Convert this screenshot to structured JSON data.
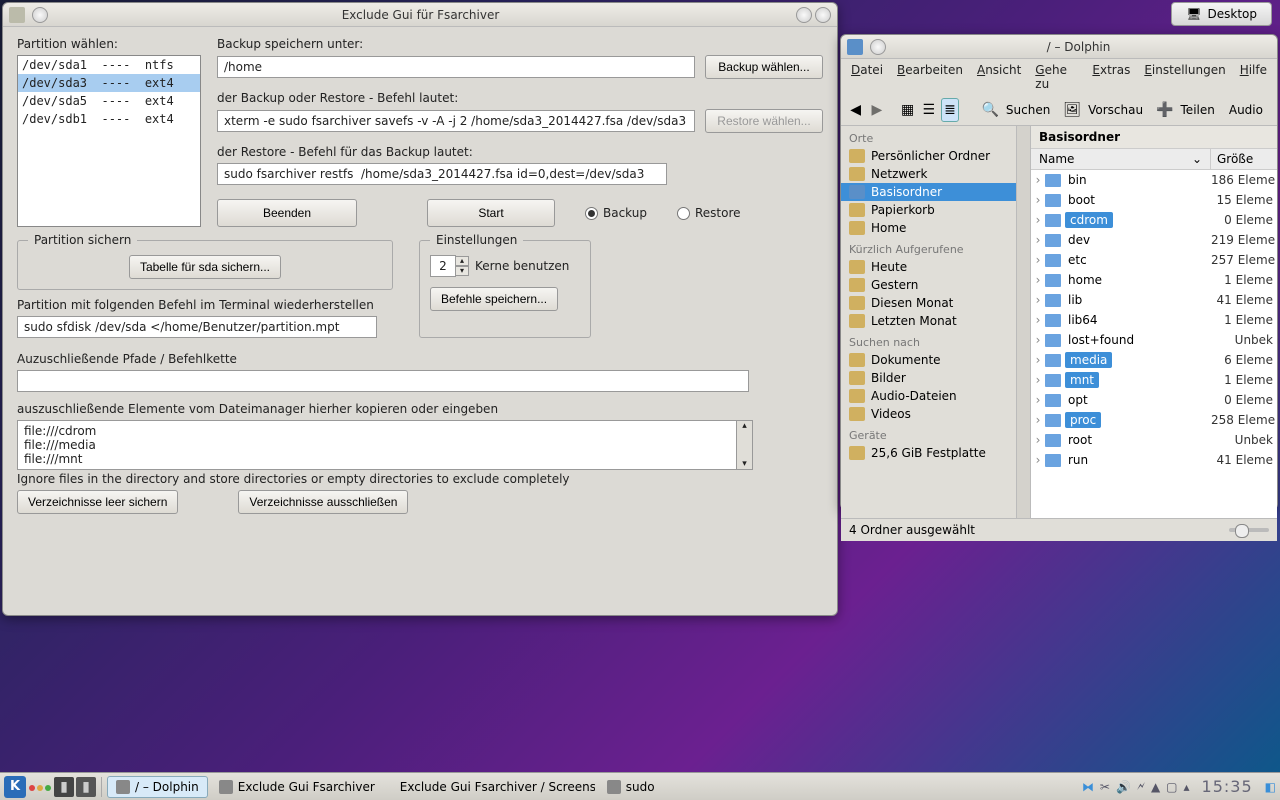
{
  "desktop_button": "Desktop",
  "fs": {
    "title": "Exclude Gui für Fsarchiver",
    "partition_label": "Partition wählen:",
    "partitions": [
      "/dev/sda1  ----  ntfs",
      "/dev/sda3  ----  ext4",
      "/dev/sda5  ----  ext4",
      "/dev/sdb1  ----  ext4"
    ],
    "partition_selected_index": 1,
    "backup_path_label": "Backup speichern unter:",
    "backup_path": "/home",
    "backup_choose_btn": "Backup wählen...",
    "cmd_label": "der Backup oder Restore - Befehl lautet:",
    "cmd_value": "xterm -e sudo fsarchiver savefs -v -A -j 2 /home/sda3_2014427.fsa /dev/sda3",
    "restore_choose_btn": "Restore wählen...",
    "restore_cmd_label": "der Restore - Befehl für das Backup lautet:",
    "restore_cmd_value": "sudo fsarchiver restfs  /home/sda3_2014427.fsa id=0,dest=/dev/sda3",
    "quit_btn": "Beenden",
    "start_btn": "Start",
    "mode_backup": "Backup",
    "mode_restore": "Restore",
    "group_partition_save": "Partition sichern",
    "table_btn": "Tabelle für sda sichern...",
    "restore_terminal_label": "Partition mit folgenden Befehl im Terminal wiederherstellen",
    "restore_terminal_cmd": "sudo sfdisk /dev/sda </home/Benutzer/partition.mpt",
    "group_settings": "Einstellungen",
    "cores_value": "2",
    "cores_label": "Kerne benutzen",
    "save_cmds_btn": "Befehle speichern...",
    "exclude_heading": "Auzuschließende Pfade / Befehlkette",
    "exclude_hint": "auszuschließende Elemente vom Dateimanager hierher kopieren oder eingeben",
    "exclude_lines": [
      "file:///cdrom",
      "file:///media",
      "file:///mnt"
    ],
    "ignore_hint": "Ignore files in the directory and store directories or empty directories to exclude completely",
    "btn_empty": "Verzeichnisse leer sichern",
    "btn_exclude": "Verzeichnisse ausschließen"
  },
  "dolphin": {
    "title": "/ – Dolphin",
    "menus": [
      "Datei",
      "Bearbeiten",
      "Ansicht",
      "Gehe zu",
      "Extras",
      "Einstellungen",
      "Hilfe"
    ],
    "tb_search": "Suchen",
    "tb_preview": "Vorschau",
    "tb_share": "Teilen",
    "tb_audio": "Audio",
    "places_header": "Orte",
    "places": [
      "Persönlicher Ordner",
      "Netzwerk",
      "Basisordner",
      "Papierkorb",
      "Home"
    ],
    "places_selected": 2,
    "recent_header": "Kürzlich Aufgerufene",
    "recent": [
      "Heute",
      "Gestern",
      "Diesen Monat",
      "Letzten Monat"
    ],
    "search_header": "Suchen nach",
    "search_items": [
      "Dokumente",
      "Bilder",
      "Audio-Dateien",
      "Videos"
    ],
    "devices_header": "Geräte",
    "devices": [
      "25,6 GiB Festplatte"
    ],
    "crumb": "Basisordner",
    "col_name": "Name",
    "col_size": "Größe",
    "files": [
      {
        "n": "bin",
        "s": "186 Eleme",
        "sel": false
      },
      {
        "n": "boot",
        "s": "15 Eleme",
        "sel": false
      },
      {
        "n": "cdrom",
        "s": "0 Eleme",
        "sel": true
      },
      {
        "n": "dev",
        "s": "219 Eleme",
        "sel": false
      },
      {
        "n": "etc",
        "s": "257 Eleme",
        "sel": false
      },
      {
        "n": "home",
        "s": "1 Eleme",
        "sel": false
      },
      {
        "n": "lib",
        "s": "41 Eleme",
        "sel": false
      },
      {
        "n": "lib64",
        "s": "1 Eleme",
        "sel": false
      },
      {
        "n": "lost+found",
        "s": "Unbek",
        "sel": false
      },
      {
        "n": "media",
        "s": "6 Eleme",
        "sel": true
      },
      {
        "n": "mnt",
        "s": "1 Eleme",
        "sel": true
      },
      {
        "n": "opt",
        "s": "0 Eleme",
        "sel": false
      },
      {
        "n": "proc",
        "s": "258 Eleme",
        "sel": true
      },
      {
        "n": "root",
        "s": "Unbek",
        "sel": false
      },
      {
        "n": "run",
        "s": "41 Eleme",
        "sel": false
      }
    ],
    "status": "4 Ordner ausgewählt"
  },
  "taskbar": {
    "items": [
      "/ – Dolphin",
      "Exclude Gui Fsarchiver",
      "Exclude Gui Fsarchiver / Screens",
      "sudo"
    ],
    "active": 0,
    "clock": "15:35"
  }
}
